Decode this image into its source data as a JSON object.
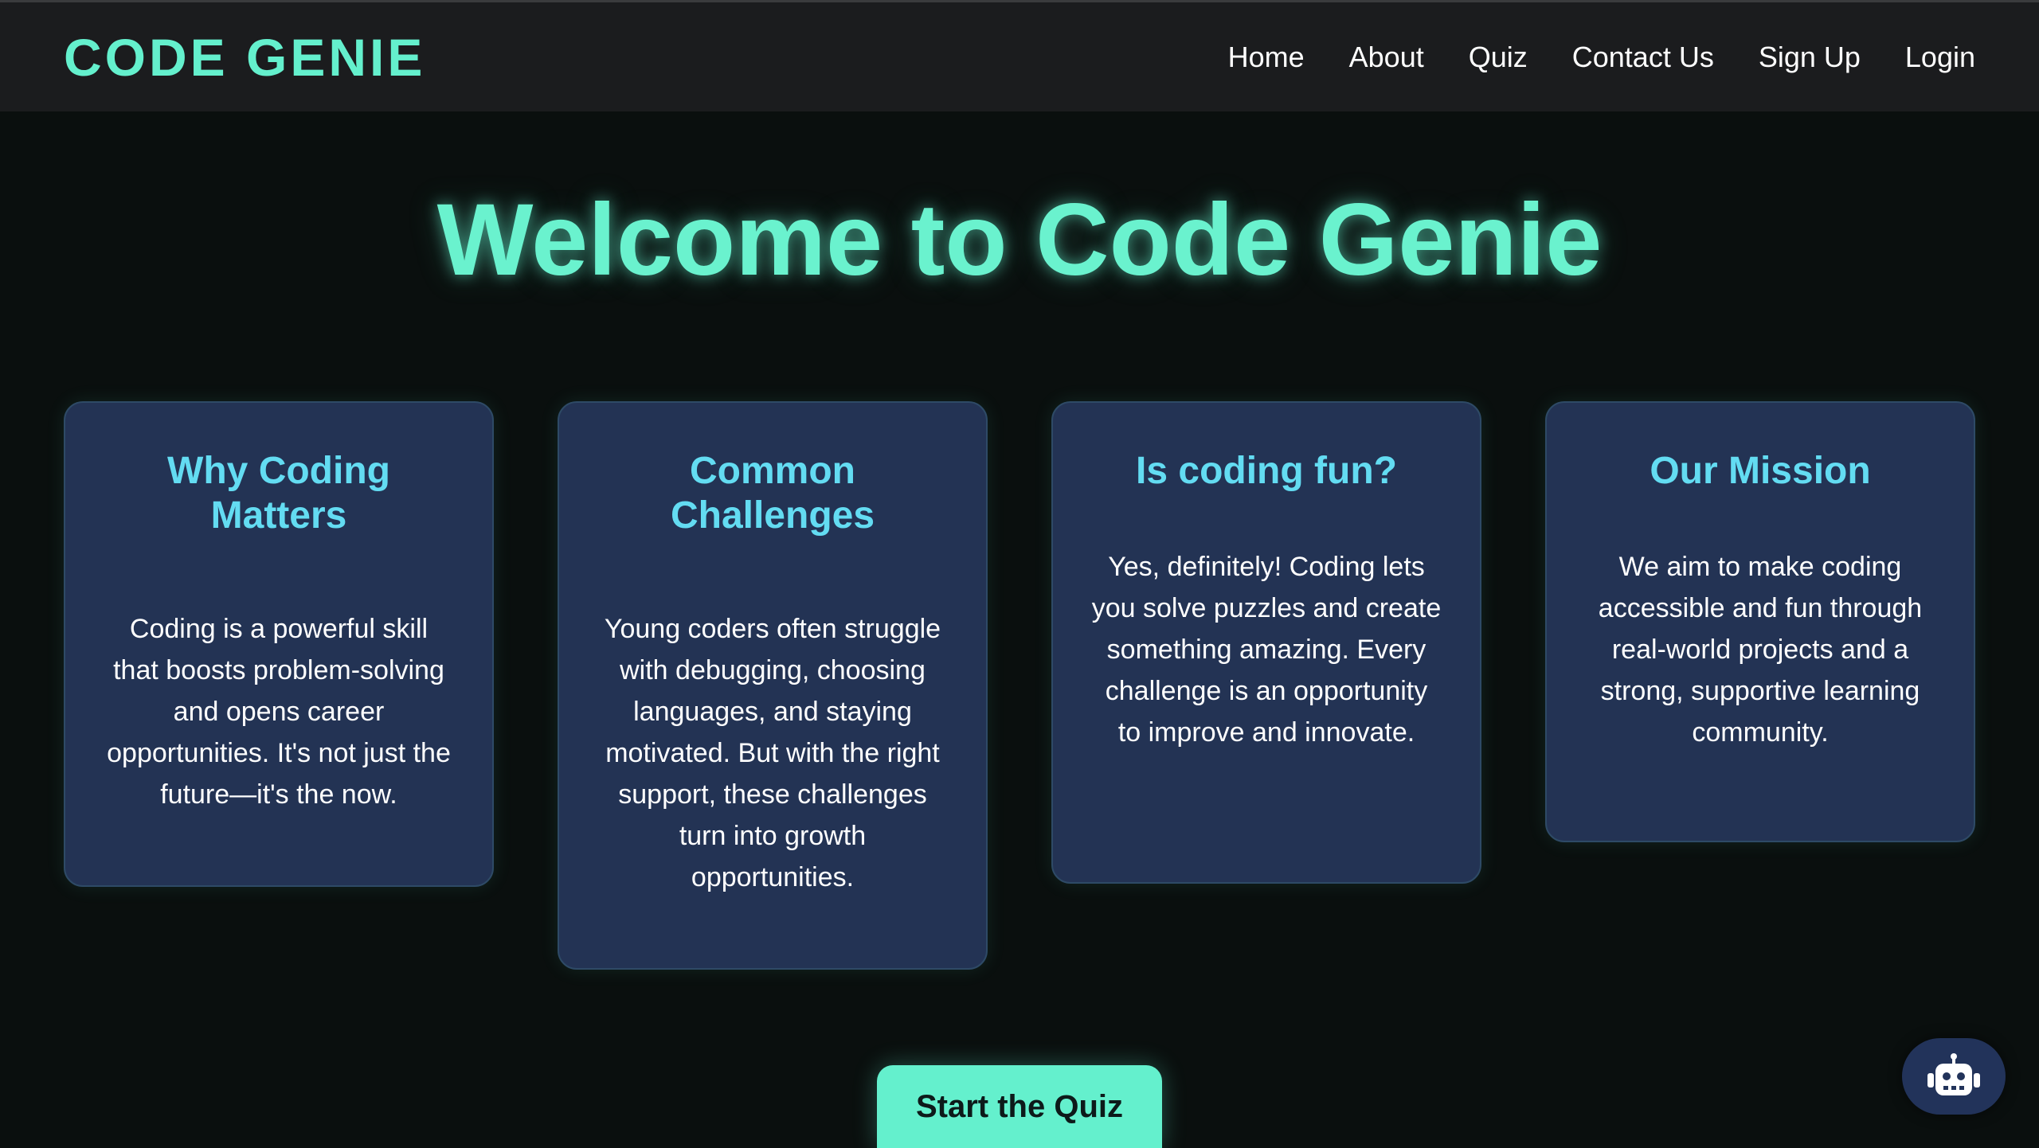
{
  "header": {
    "logo": "CODE GENIE",
    "nav": [
      "Home",
      "About",
      "Quiz",
      "Contact Us",
      "Sign Up",
      "Login"
    ]
  },
  "hero": {
    "title": "Welcome to Code Genie"
  },
  "cards": [
    {
      "title": "Why Coding Matters",
      "text": "Coding is a powerful skill that boosts problem-solving and opens career opportunities. It's not just the future—it's the now."
    },
    {
      "title": "Common Challenges",
      "text": "Young coders often struggle with debugging, choosing languages, and staying motivated. But with the right support, these challenges turn into growth opportunities."
    },
    {
      "title": "Is coding fun?",
      "text": "Yes, definitely! Coding lets you solve puzzles and create something amazing. Every challenge is an opportunity to improve and innovate."
    },
    {
      "title": "Our Mission",
      "text": "We aim to make coding accessible and fun through real-world projects and a strong, supportive learning community."
    }
  ],
  "cta": {
    "label": "Start the Quiz"
  },
  "chatbot": {
    "icon": "robot-icon"
  },
  "colors": {
    "accent": "#64f0cd",
    "card_title": "#63dcf2",
    "card_bg": "#233354",
    "page_bg": "#0a0f0e",
    "header_bg": "#1b1c1e"
  }
}
